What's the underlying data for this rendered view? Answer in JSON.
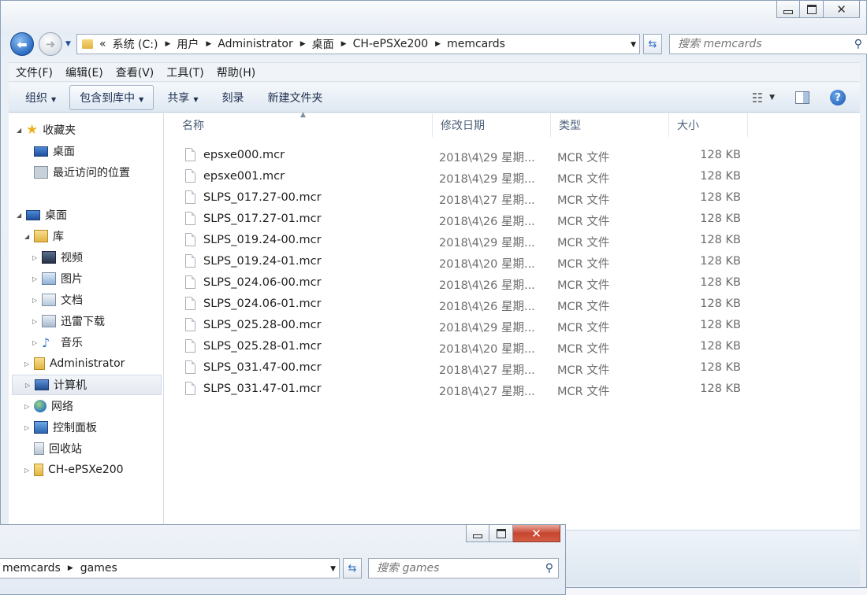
{
  "window": {
    "controls": {
      "minimize_icon": "minimize-icon",
      "maximize_icon": "maximize-icon",
      "close_icon": "close-icon"
    }
  },
  "address": {
    "overflow": "«",
    "crumbs": [
      "系统 (C:)",
      "用户",
      "Administrator",
      "桌面",
      "CH-ePSXe200",
      "memcards"
    ],
    "search_placeholder": "搜索 memcards"
  },
  "menu": [
    "文件(F)",
    "编辑(E)",
    "查看(V)",
    "工具(T)",
    "帮助(H)"
  ],
  "toolbar": {
    "organize": "组织",
    "include_library": "包含到库中",
    "share": "共享",
    "burn": "刻录",
    "new_folder": "新建文件夹"
  },
  "nav": {
    "favorites": "收藏夹",
    "desktop_fav": "桌面",
    "recent": "最近访问的位置",
    "desktop": "桌面",
    "library": "库",
    "videos": "视频",
    "pictures": "图片",
    "documents": "文档",
    "xunlei": "迅雷下载",
    "music": "音乐",
    "admin": "Administrator",
    "computer": "计算机",
    "network": "网络",
    "control_panel": "控制面板",
    "recycle": "回收站",
    "epsxe": "CH-ePSXe200"
  },
  "columns": {
    "name": "名称",
    "date": "修改日期",
    "type": "类型",
    "size": "大小"
  },
  "files": [
    {
      "name": "epsxe000.mcr",
      "date": "2018\\4\\29 星期...",
      "type": "MCR 文件",
      "size": "128 KB"
    },
    {
      "name": "epsxe001.mcr",
      "date": "2018\\4\\29 星期...",
      "type": "MCR 文件",
      "size": "128 KB"
    },
    {
      "name": "SLPS_017.27-00.mcr",
      "date": "2018\\4\\27 星期...",
      "type": "MCR 文件",
      "size": "128 KB"
    },
    {
      "name": "SLPS_017.27-01.mcr",
      "date": "2018\\4\\26 星期...",
      "type": "MCR 文件",
      "size": "128 KB"
    },
    {
      "name": "SLPS_019.24-00.mcr",
      "date": "2018\\4\\29 星期...",
      "type": "MCR 文件",
      "size": "128 KB"
    },
    {
      "name": "SLPS_019.24-01.mcr",
      "date": "2018\\4\\20 星期...",
      "type": "MCR 文件",
      "size": "128 KB"
    },
    {
      "name": "SLPS_024.06-00.mcr",
      "date": "2018\\4\\26 星期...",
      "type": "MCR 文件",
      "size": "128 KB"
    },
    {
      "name": "SLPS_024.06-01.mcr",
      "date": "2018\\4\\26 星期...",
      "type": "MCR 文件",
      "size": "128 KB"
    },
    {
      "name": "SLPS_025.28-00.mcr",
      "date": "2018\\4\\29 星期...",
      "type": "MCR 文件",
      "size": "128 KB"
    },
    {
      "name": "SLPS_025.28-01.mcr",
      "date": "2018\\4\\20 星期...",
      "type": "MCR 文件",
      "size": "128 KB"
    },
    {
      "name": "SLPS_031.47-00.mcr",
      "date": "2018\\4\\27 星期...",
      "type": "MCR 文件",
      "size": "128 KB"
    },
    {
      "name": "SLPS_031.47-01.mcr",
      "date": "2018\\4\\27 星期...",
      "type": "MCR 文件",
      "size": "128 KB"
    }
  ],
  "window2": {
    "crumbs": [
      "memcards",
      "games"
    ],
    "search_placeholder": "搜索 games"
  }
}
